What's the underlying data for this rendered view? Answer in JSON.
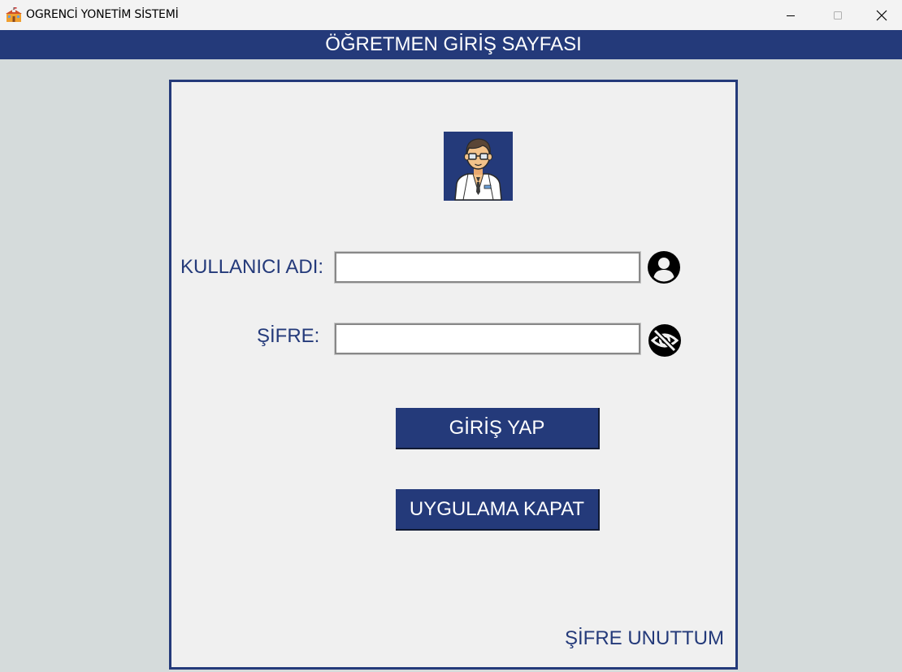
{
  "window": {
    "title": "OGRENCİ YONETİM SİSTEMİ",
    "app_icon": "school-building-icon",
    "controls": [
      "minimize-icon",
      "maximize-icon",
      "close-icon"
    ]
  },
  "header": {
    "title": "ÖĞRETMEN GİRİŞ SAYFASI"
  },
  "login": {
    "avatar_icon": "teacher-avatar-icon",
    "username_label": "KULLANICI ADI:",
    "username_value": "",
    "username_icon": "user-circle-icon",
    "password_label": "ŞİFRE:",
    "password_value": "",
    "password_icon": "eye-slash-icon",
    "login_button": "GİRİŞ YAP",
    "exit_button": "UYGULAMA KAPAT",
    "forgot_link": "ŞİFRE UNUTTUM"
  },
  "colors": {
    "primary": "#243a7a",
    "background": "#d5dbdb",
    "panel": "#f0f0f0"
  }
}
